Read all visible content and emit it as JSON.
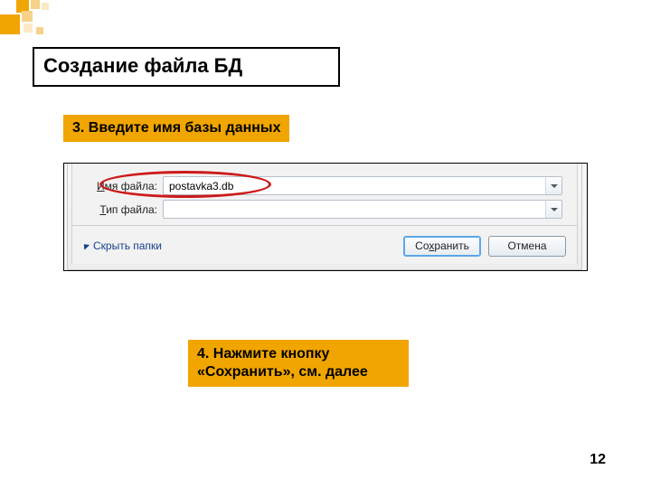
{
  "title": "Создание файла БД",
  "callouts": {
    "step3": "3. Введите имя базы данных",
    "step4": "4. Нажмите кнопку «Сохранить», см. далее"
  },
  "dialog": {
    "label_filename_pre": "",
    "label_filename_ul": "И",
    "label_filename_post": "мя файла:",
    "label_filetype_pre": "",
    "label_filetype_ul": "Т",
    "label_filetype_post": "ип файла:",
    "filename_value": "postavka3.db",
    "filetype_value": "",
    "hide_folders": "Скрыть папки",
    "btn_save_pre": "Со",
    "btn_save_ul": "х",
    "btn_save_post": "ранить",
    "btn_cancel": "Отмена"
  },
  "page_number": "12"
}
